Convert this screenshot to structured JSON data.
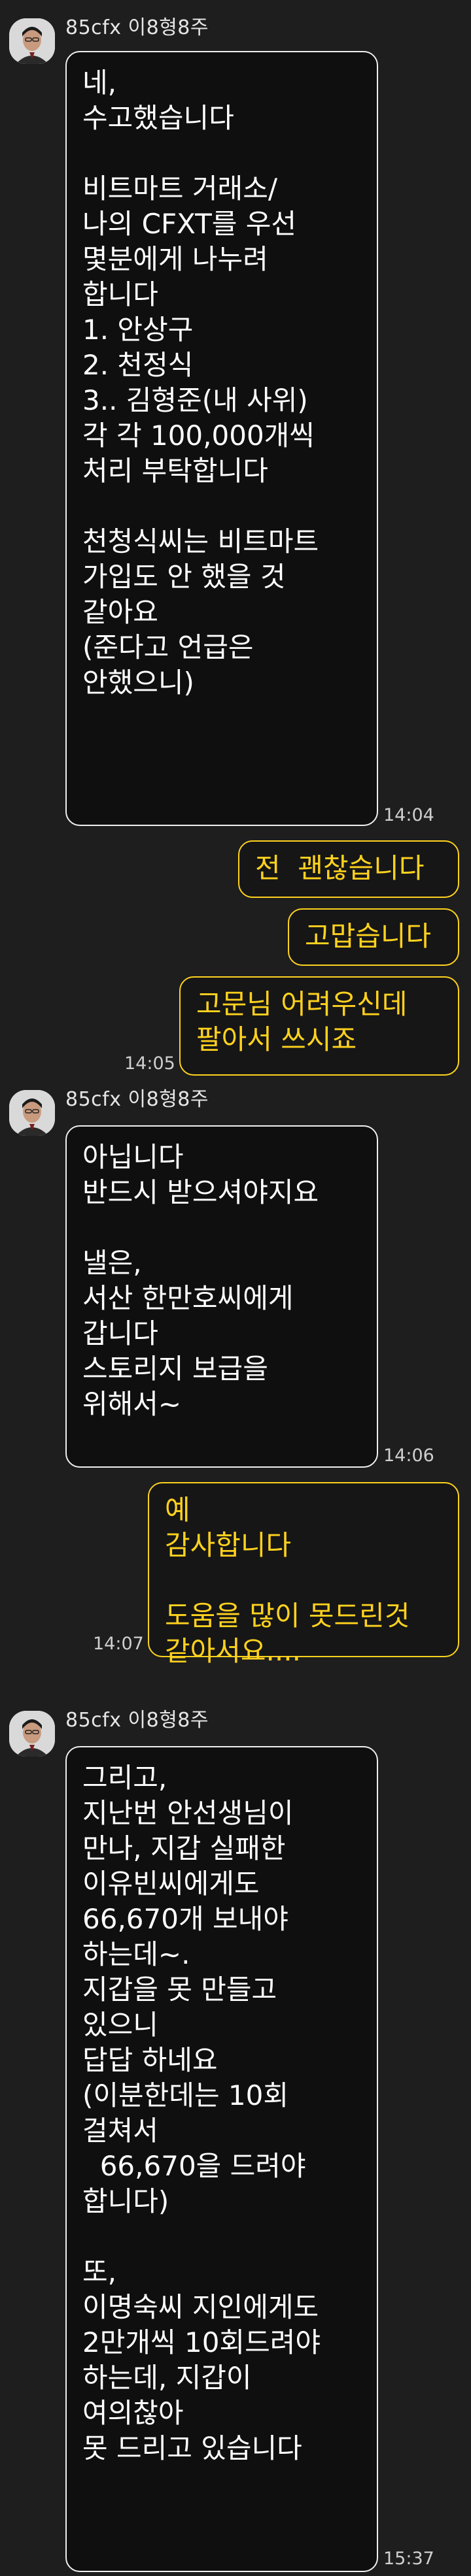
{
  "chat": {
    "sender_name": "85cfx 이8형8주",
    "accent_color": "#ffd21e",
    "messages": [
      {
        "text": "네,\n수고했습니다\n\n비트마트 거래소/\n나의 CFXT를 우선\n몇분에게 나누려\n합니다\n1. 안상구\n2. 천정식\n3.. 김형준(내 사위)\n각 각 100,000개씩\n처리 부탁합니다\n\n천청식씨는 비트마트\n가입도 안 했을 것\n같아요\n(준다고 언급은\n안했으니)",
        "time": "14:04"
      },
      {
        "text": "전  괜찮습니다"
      },
      {
        "text": "고맙습니다"
      },
      {
        "text": "고문님 어려우신데\n팔아서 쓰시죠",
        "time": "14:05"
      },
      {
        "text": "아닙니다\n반드시 받으셔야지요\n\n낼은,\n서산 한만호씨에게\n갑니다\n스토리지 보급을\n위해서~",
        "time": "14:06"
      },
      {
        "text": "예\n감사합니다\n\n도움을 많이 못드린것\n같아서요....",
        "time": "14:07"
      },
      {
        "text": "그리고,\n지난번 안선생님이\n만나, 지갑 실패한\n이유빈씨에게도\n66,670개 보내야\n하는데~.\n지갑을 못 만들고\n있으니\n답답 하네요\n(이분한데는 10회\n걸쳐서\n  66,670을 드려야\n합니다)\n\n또,\n이명숙씨 지인에게도\n2만개씩 10회드려야\n하는데, 지갑이\n여의찮아\n못 드리고 있습니다",
        "time": "15:37"
      }
    ]
  }
}
